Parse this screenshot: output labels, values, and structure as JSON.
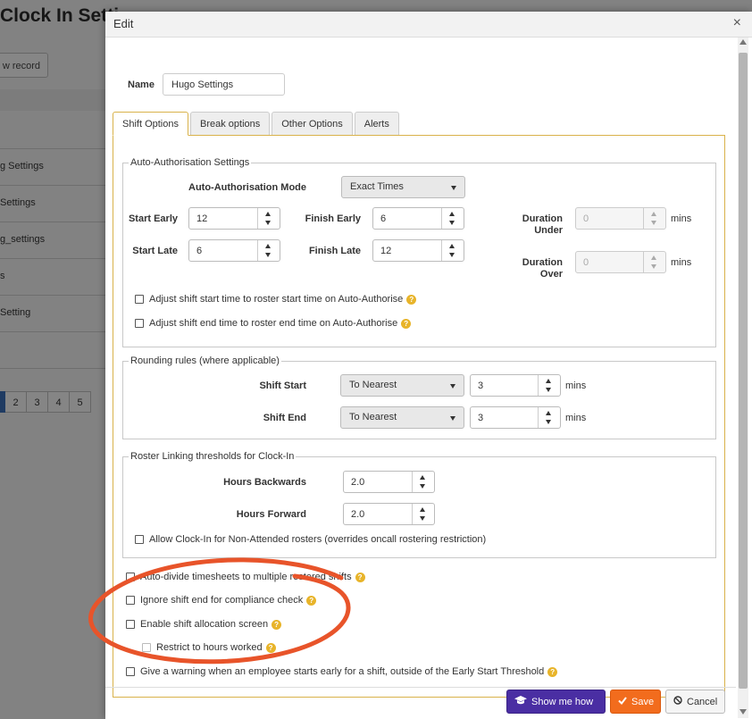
{
  "background": {
    "title": "Clock In Setti",
    "new_record_label": "w record",
    "rows": [
      "g Settings",
      "Settings",
      "g_settings",
      "s",
      "Setting"
    ],
    "pager": [
      "2",
      "3",
      "4",
      "5"
    ]
  },
  "modal": {
    "title": "Edit",
    "close_label": "×",
    "name_label": "Name",
    "name_value": "Hugo Settings"
  },
  "tabs": [
    {
      "label": "Shift Options",
      "active": true
    },
    {
      "label": "Break options",
      "active": false
    },
    {
      "label": "Other Options",
      "active": false
    },
    {
      "label": "Alerts",
      "active": false
    }
  ],
  "auto_auth": {
    "legend": "Auto-Authorisation Settings",
    "mode_label": "Auto-Authorisation Mode",
    "mode_value": "Exact Times",
    "start_early_label": "Start Early",
    "start_early_value": "12",
    "finish_early_label": "Finish Early",
    "finish_early_value": "6",
    "start_late_label": "Start Late",
    "start_late_value": "6",
    "finish_late_label": "Finish Late",
    "finish_late_value": "12",
    "duration_under_label_1": "Duration",
    "duration_under_label_2": "Under",
    "duration_under_value": "0",
    "duration_over_label_1": "Duration",
    "duration_over_label_2": "Over",
    "duration_over_value": "0",
    "mins": "mins",
    "check_start": "Adjust shift start time to roster start time on Auto-Authorise",
    "check_end": "Adjust shift end time to roster end time on Auto-Authorise"
  },
  "rounding": {
    "legend": "Rounding rules (where applicable)",
    "shift_start_label": "Shift Start",
    "shift_start_mode": "To Nearest",
    "shift_start_value": "3",
    "shift_end_label": "Shift End",
    "shift_end_mode": "To Nearest",
    "shift_end_value": "3",
    "mins": "mins"
  },
  "roster_link": {
    "legend": "Roster Linking thresholds for Clock-In",
    "hours_back_label": "Hours Backwards",
    "hours_back_value": "2.0",
    "hours_fwd_label": "Hours Forward",
    "hours_fwd_value": "2.0",
    "check_allow": "Allow Clock-In for Non-Attended rosters (overrides oncall rostering restriction)"
  },
  "options": {
    "auto_divide": "Auto-divide timesheets to multiple rostered shifts",
    "ignore_end": "Ignore shift end for compliance check",
    "enable_alloc": "Enable shift allocation screen",
    "restrict_hours": "Restrict to hours worked",
    "give_warning": "Give a warning when an employee starts early for a shift, outside of the Early Start Threshold"
  },
  "help_glyph": "?",
  "footer": {
    "show_me_how": "Show me how",
    "save": "Save",
    "cancel": "Cancel"
  },
  "colors": {
    "accent_gold": "#d9b24a",
    "help_icon": "#e8b42a",
    "show_me_how": "#4a2ea3",
    "save": "#f26c1d",
    "annotation": "#e8542a"
  }
}
